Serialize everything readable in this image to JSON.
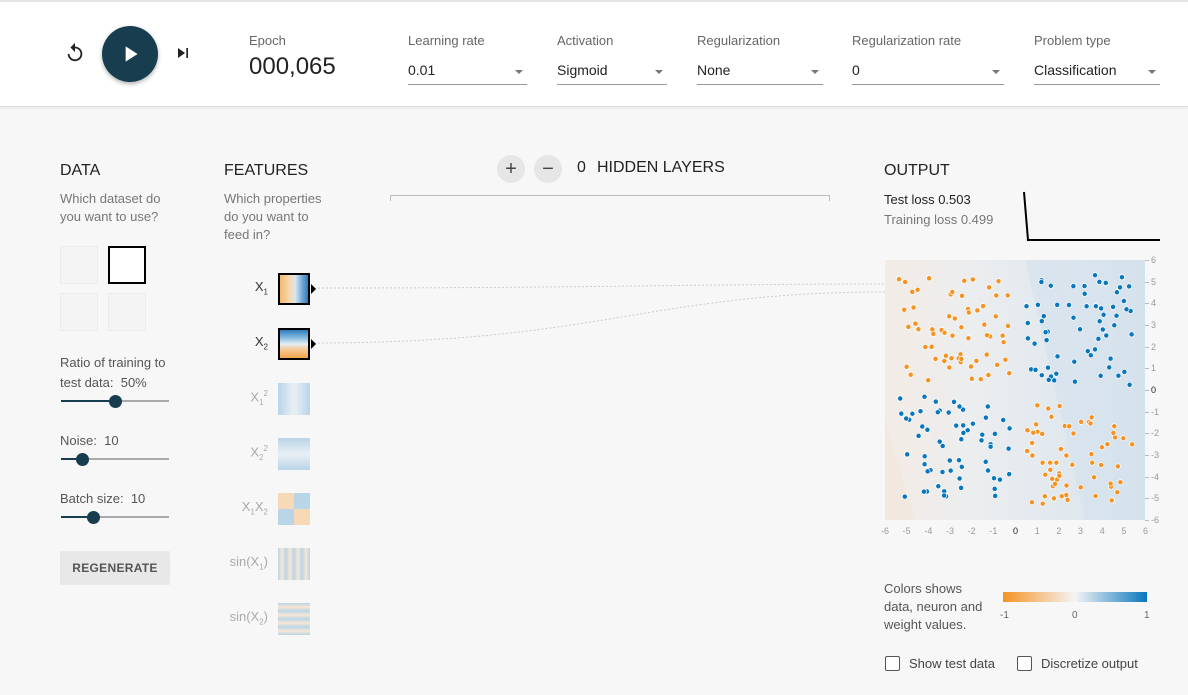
{
  "controls": {
    "epoch_label": "Epoch",
    "epoch_value": "000,065"
  },
  "selects": [
    {
      "label": "Learning rate",
      "value": "0.01"
    },
    {
      "label": "Activation",
      "value": "Sigmoid"
    },
    {
      "label": "Regularization",
      "value": "None"
    },
    {
      "label": "Regularization rate",
      "value": "0"
    },
    {
      "label": "Problem type",
      "value": "Classification"
    }
  ],
  "data_panel": {
    "title": "DATA",
    "description": "Which dataset do you want to use?",
    "ratio_label": "Ratio of training to test data:",
    "ratio_value": "50%",
    "ratio_fraction": 0.5,
    "noise_label": "Noise:",
    "noise_value": "10",
    "noise_fraction": 0.2,
    "batch_label": "Batch size:",
    "batch_value": "10",
    "batch_fraction": 0.3,
    "regenerate_label": "REGENERATE"
  },
  "features_panel": {
    "title": "FEATURES",
    "description": "Which properties do you want to feed in?"
  },
  "hidden_layers": {
    "count": "0",
    "label": "HIDDEN LAYERS"
  },
  "output_panel": {
    "title": "OUTPUT",
    "test_loss_label": "Test loss",
    "test_loss_value": "0.503",
    "training_loss_label": "Training loss",
    "training_loss_value": "0.499",
    "y_axis_ticks": [
      "6",
      "5",
      "4",
      "3",
      "2",
      "1",
      "0",
      "-1",
      "-2",
      "-3",
      "-4",
      "-5",
      "-6"
    ],
    "x_axis_ticks": [
      "-6",
      "-5",
      "-4",
      "-3",
      "-2",
      "-1",
      "0",
      "1",
      "2",
      "3",
      "4",
      "5",
      "6"
    ],
    "legend_text": "Colors shows data, neuron and weight values.",
    "colorbar_ticks": [
      "-1",
      "0",
      "1"
    ],
    "show_test_data_label": "Show test data",
    "discretize_label": "Discretize output"
  },
  "colors": {
    "orange": "#f59322",
    "blue": "#0877bd",
    "dark": "#183d4e"
  }
}
